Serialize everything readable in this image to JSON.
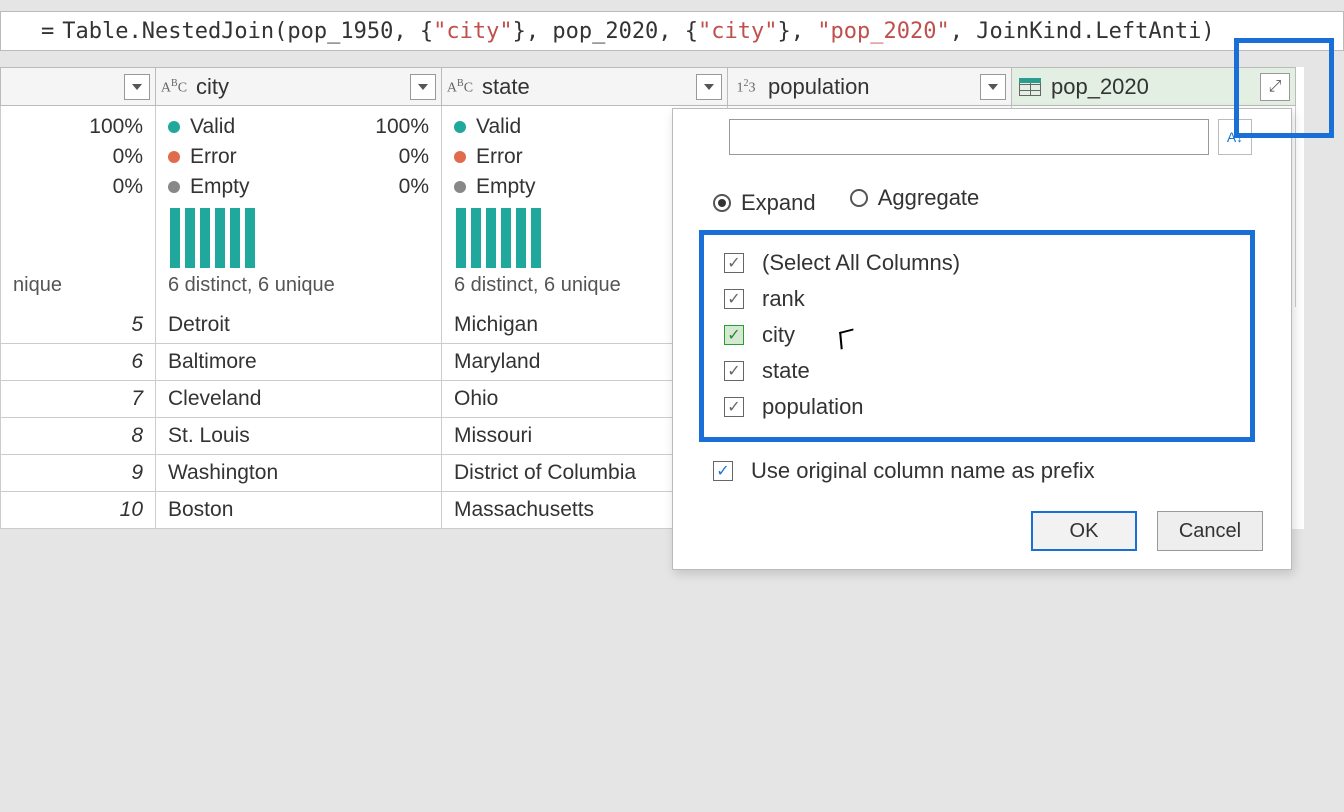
{
  "formula": {
    "eq": "=",
    "parts": [
      {
        "t": "Table.NestedJoin(pop_1950, {",
        "c": "fn"
      },
      {
        "t": "\"city\"",
        "c": "str-red"
      },
      {
        "t": "}, pop_2020, {",
        "c": "fn"
      },
      {
        "t": "\"city\"",
        "c": "str-red"
      },
      {
        "t": "}, ",
        "c": "fn"
      },
      {
        "t": "\"pop_2020\"",
        "c": "str-red"
      },
      {
        "t": ", JoinKind.LeftAnti)",
        "c": "fn"
      }
    ]
  },
  "columns": [
    {
      "name": "",
      "type": "",
      "width": "col0"
    },
    {
      "name": "city",
      "type": "ABC",
      "width": "col1"
    },
    {
      "name": "state",
      "type": "ABC",
      "width": "col2"
    },
    {
      "name": "population",
      "type": "123",
      "width": "col3"
    },
    {
      "name": "pop_2020",
      "type": "table",
      "width": "col4",
      "selected": true
    }
  ],
  "quality": {
    "valid": {
      "label": "Valid",
      "pct": "100%"
    },
    "error": {
      "label": "Error",
      "pct": "0%"
    },
    "empty": {
      "label": "Empty",
      "pct": "0%"
    },
    "distinct": "6 distinct, 6 unique",
    "unique_label": "nique",
    "partial": "1"
  },
  "rows": [
    {
      "n": "5",
      "city": "Detroit",
      "state": "Michigan"
    },
    {
      "n": "6",
      "city": "Baltimore",
      "state": "Maryland"
    },
    {
      "n": "7",
      "city": "Cleveland",
      "state": "Ohio"
    },
    {
      "n": "8",
      "city": "St. Louis",
      "state": "Missouri"
    },
    {
      "n": "9",
      "city": "Washington",
      "state": "District of Columbia"
    },
    {
      "n": "10",
      "city": "Boston",
      "state": "Massachusetts"
    }
  ],
  "popup": {
    "search_placeholder": "",
    "mode": {
      "expand": "Expand",
      "aggregate": "Aggregate"
    },
    "select_all": "(Select All Columns)",
    "cols": [
      "rank",
      "city",
      "state",
      "population"
    ],
    "active_index": 1,
    "prefix": "Use original column name as prefix",
    "ok": "OK",
    "cancel": "Cancel",
    "sort": "A↓"
  }
}
